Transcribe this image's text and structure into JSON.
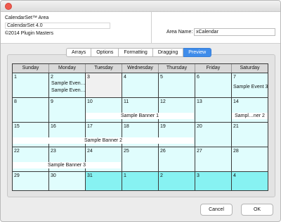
{
  "window": {
    "close_icon": "close-icon"
  },
  "header": {
    "area_title": "CalendarSet™ Area",
    "version": "CalendarSet 4.0",
    "copyright": "©2014 Plugin Masters",
    "area_name_label": "Area Name:",
    "area_name_value": "xCalendar"
  },
  "tabs": [
    {
      "label": "Arrays"
    },
    {
      "label": "Options"
    },
    {
      "label": "Formatting"
    },
    {
      "label": "Dragging"
    },
    {
      "label": "Preview",
      "active": true
    }
  ],
  "calendar": {
    "day_names": [
      "Sunday",
      "Monday",
      "Tuesday",
      "Wednesday",
      "Thursday",
      "Friday",
      "Saturday"
    ],
    "weeks": [
      [
        "1",
        "2",
        "3",
        "4",
        "5",
        "6",
        "7"
      ],
      [
        "8",
        "9",
        "10",
        "11",
        "12",
        "13",
        "14"
      ],
      [
        "15",
        "16",
        "17",
        "18",
        "19",
        "20",
        "21"
      ],
      [
        "22",
        "23",
        "24",
        "25",
        "26",
        "27",
        "28"
      ],
      [
        "29",
        "30",
        "31",
        "1",
        "2",
        "3",
        "4"
      ]
    ],
    "events": {
      "e1": "Sample Even…",
      "e2": "Sample Even…",
      "e3": "Sample Event 3"
    },
    "banners": {
      "b1": "Sample Banner 1",
      "b2": "Sampl…ner 2",
      "b3": "Sample Banner 2",
      "b4": "Sample Banner 3"
    },
    "colors": {
      "current_month": "#e0fdfd",
      "other_month": "#87f2f2",
      "weekday_out": "#f0f0f0",
      "grid": "#3b3b3b"
    }
  },
  "buttons": {
    "cancel": "Cancel",
    "ok": "OK"
  }
}
